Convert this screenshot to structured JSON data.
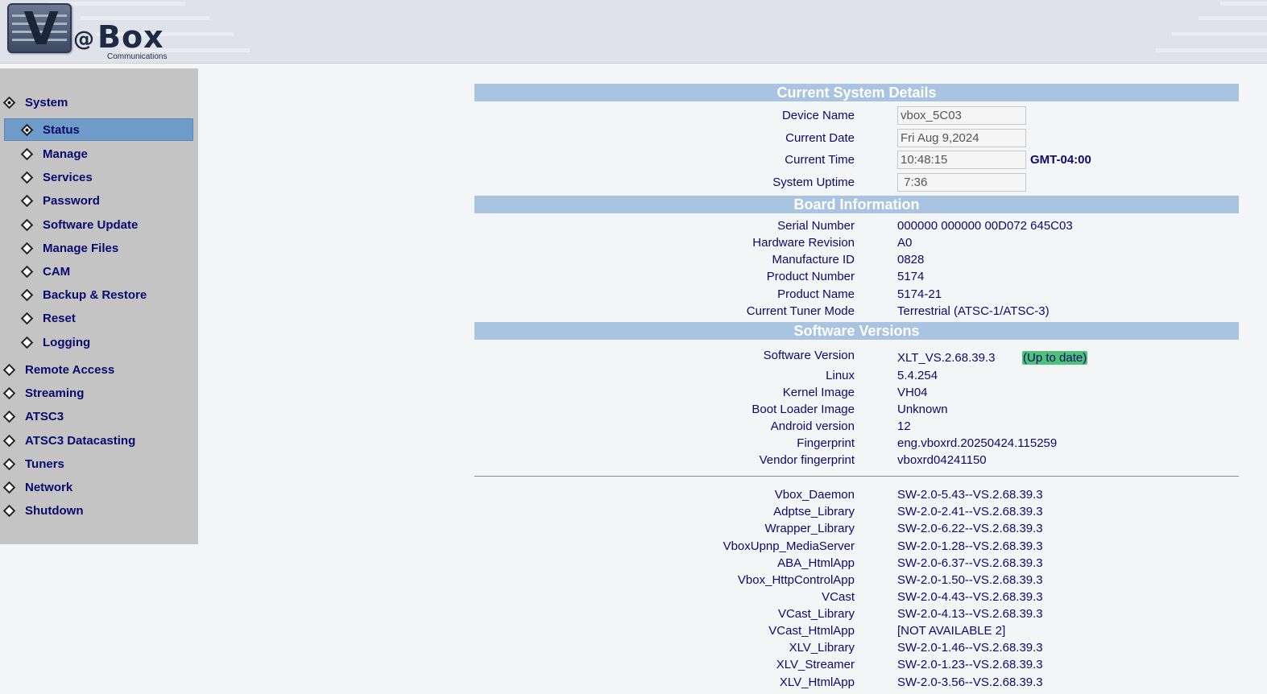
{
  "header": {
    "logo_letter": "V",
    "logo_at": "@",
    "logo_word": "Box",
    "logo_sub": "Communications"
  },
  "sidebar": {
    "items": [
      {
        "label": "System",
        "level": 0,
        "active": false,
        "filled": true
      },
      {
        "label": "Status",
        "level": 1,
        "active": true,
        "filled": true
      },
      {
        "label": "Manage",
        "level": 1
      },
      {
        "label": "Services",
        "level": 1
      },
      {
        "label": "Password",
        "level": 1
      },
      {
        "label": "Software Update",
        "level": 1
      },
      {
        "label": "Manage Files",
        "level": 1
      },
      {
        "label": "CAM",
        "level": 1
      },
      {
        "label": "Backup & Restore",
        "level": 1
      },
      {
        "label": "Reset",
        "level": 1
      },
      {
        "label": "Logging",
        "level": 1
      },
      {
        "label": "Remote Access",
        "level": 0
      },
      {
        "label": "Streaming",
        "level": 0
      },
      {
        "label": "ATSC3",
        "level": 0
      },
      {
        "label": "ATSC3 Datacasting",
        "level": 0
      },
      {
        "label": "Tuners",
        "level": 0
      },
      {
        "label": "Network",
        "level": 0
      },
      {
        "label": "Shutdown",
        "level": 0
      }
    ]
  },
  "system_details": {
    "title": "Current System Details",
    "device_name_label": "Device Name",
    "device_name": "vbox_5C03",
    "current_date_label": "Current Date",
    "current_date": "Fri Aug 9,2024",
    "current_time_label": "Current Time",
    "current_time": "10:48:15",
    "timezone": "GMT-04:00",
    "uptime_label": "System Uptime",
    "uptime": " 7:36"
  },
  "board": {
    "title": "Board Information",
    "rows": [
      {
        "label": "Serial Number",
        "value": "000000 000000 00D072 645C03"
      },
      {
        "label": "Hardware Revision",
        "value": "A0"
      },
      {
        "label": "Manufacture ID",
        "value": "0828"
      },
      {
        "label": "Product Number",
        "value": "5174"
      },
      {
        "label": "Product Name",
        "value": "5174-21"
      },
      {
        "label": "Current Tuner Mode",
        "value": "Terrestrial (ATSC-1/ATSC-3)"
      }
    ]
  },
  "software": {
    "title": "Software Versions",
    "version_label": "Software Version",
    "version": "XLT_VS.2.68.39.3",
    "status": "(Up to date)",
    "rows": [
      {
        "label": "Linux",
        "value": "5.4.254"
      },
      {
        "label": "Kernel Image",
        "value": "VH04"
      },
      {
        "label": "Boot Loader Image",
        "value": "Unknown"
      },
      {
        "label": "Android version",
        "value": "12"
      },
      {
        "label": "Fingerprint",
        "value": "eng.vboxrd.20250424.115259"
      },
      {
        "label": "Vendor fingerprint",
        "value": "vboxrd04241150"
      }
    ],
    "components": [
      {
        "label": "Vbox_Daemon",
        "value": "SW-2.0-5.43--VS.2.68.39.3"
      },
      {
        "label": "Adptse_Library",
        "value": "SW-2.0-2.41--VS.2.68.39.3"
      },
      {
        "label": "Wrapper_Library",
        "value": "SW-2.0-6.22--VS.2.68.39.3"
      },
      {
        "label": "VboxUpnp_MediaServer",
        "value": "SW-2.0-1.28--VS.2.68.39.3"
      },
      {
        "label": "ABA_HtmlApp",
        "value": "SW-2.0-6.37--VS.2.68.39.3"
      },
      {
        "label": "Vbox_HttpControlApp",
        "value": "SW-2.0-1.50--VS.2.68.39.3"
      },
      {
        "label": "VCast",
        "value": "SW-2.0-4.43--VS.2.68.39.3"
      },
      {
        "label": "VCast_Library",
        "value": "SW-2.0-4.13--VS.2.68.39.3"
      },
      {
        "label": "VCast_HtmlApp",
        "value": "[NOT AVAILABLE 2]"
      },
      {
        "label": "XLV_Library",
        "value": "SW-2.0-1.46--VS.2.68.39.3"
      },
      {
        "label": "XLV_Streamer",
        "value": "SW-2.0-1.23--VS.2.68.39.3"
      },
      {
        "label": "XLV_HtmlApp",
        "value": "SW-2.0-3.56--VS.2.68.39.3"
      }
    ]
  }
}
